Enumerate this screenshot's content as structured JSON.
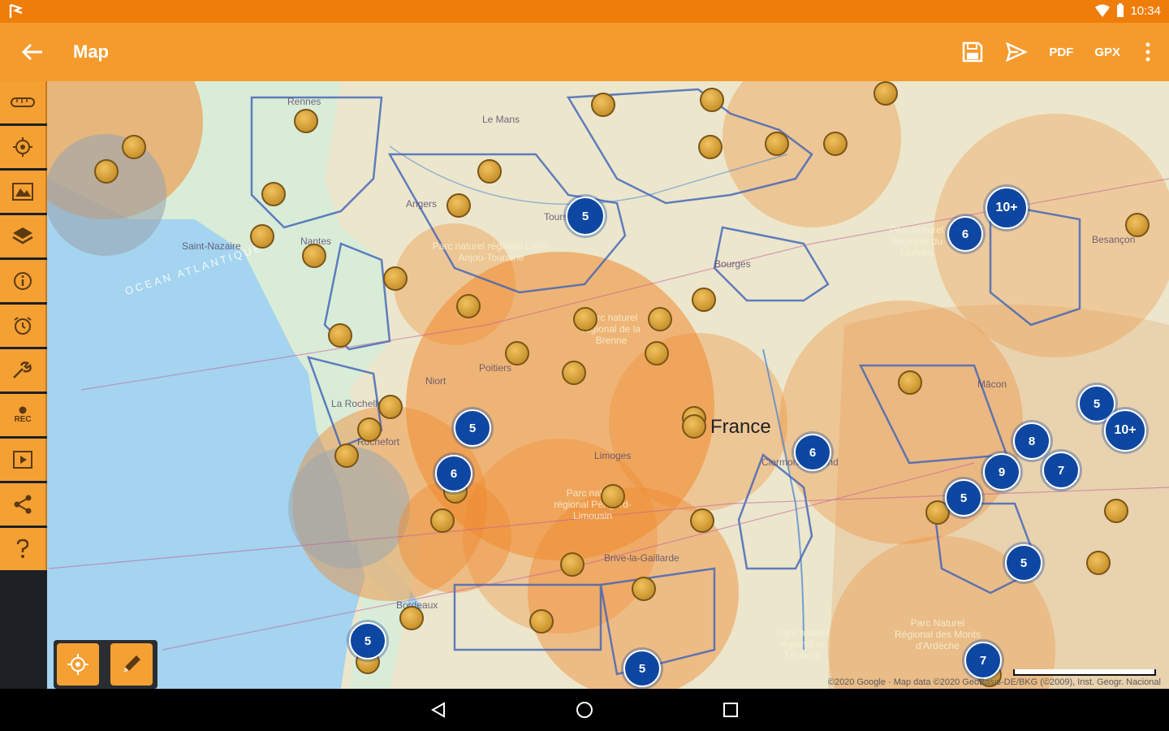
{
  "status_bar": {
    "time": "10:34"
  },
  "toolbar": {
    "title": "Map",
    "pdf_label": "PDF",
    "gpx_label": "GPX"
  },
  "map": {
    "country_label": "France",
    "cities": [
      {
        "name": "Rennes"
      },
      {
        "name": "Le Mans"
      },
      {
        "name": "Angers"
      },
      {
        "name": "Nantes"
      },
      {
        "name": "Saint-Nazaire"
      },
      {
        "name": "Tours"
      },
      {
        "name": "Bourges"
      },
      {
        "name": "Besançon"
      },
      {
        "name": "Niort"
      },
      {
        "name": "La Rochelle"
      },
      {
        "name": "Rochefort"
      },
      {
        "name": "Poitiers"
      },
      {
        "name": "Limoges"
      },
      {
        "name": "Clermont-Ferrand"
      },
      {
        "name": "Brive-la-Gaillarde"
      },
      {
        "name": "Mâcon"
      },
      {
        "name": "Bordeaux"
      },
      {
        "name": "OCEAN ATLANTIQUE"
      },
      {
        "name": "Parc naturel régional de la Brenne"
      },
      {
        "name": "Parc naturel régional Loire-Anjou-Touraine"
      },
      {
        "name": "Parc Naturel Régional du Morvan"
      },
      {
        "name": "Parc naturel régional Périgord-Limousin"
      },
      {
        "name": "Parc naturel régional de l'Aubrac"
      },
      {
        "name": "Parc Naturel Régional des Monts d'Ardèche"
      }
    ],
    "clusters": [
      {
        "count": "5"
      },
      {
        "count": "10+"
      },
      {
        "count": "6"
      },
      {
        "count": "5"
      },
      {
        "count": "6"
      },
      {
        "count": "6"
      },
      {
        "count": "5"
      },
      {
        "count": "10+"
      },
      {
        "count": "8"
      },
      {
        "count": "9"
      },
      {
        "count": "7"
      },
      {
        "count": "5"
      },
      {
        "count": "5"
      },
      {
        "count": "5"
      },
      {
        "count": "5"
      },
      {
        "count": "7"
      }
    ],
    "attribution": "©2020 Google · Map data ©2020 GeoBasis-DE/BKG (©2009), Inst. Geogr. Nacional"
  },
  "sidebar": {
    "rec_label": "REC"
  },
  "colors": {
    "accent": "#f59b2d",
    "status_bar": "#ef7d0a",
    "cluster": "#0d47a1",
    "water": "#a4d4ef"
  }
}
